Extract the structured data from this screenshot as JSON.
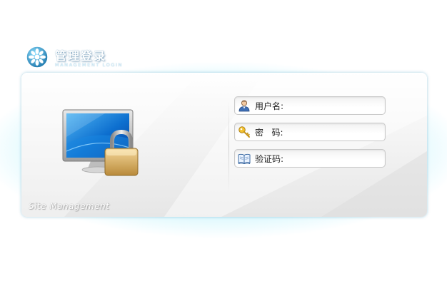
{
  "header": {
    "title": "管理登录",
    "subtitle": "MANAGEMENT LOGIN",
    "logo_icon": "gear-wheel-logo-icon"
  },
  "panel": {
    "illustration_icon": "monitor-padlock-icon",
    "watermark": "Site Management"
  },
  "form": {
    "username": {
      "label": "用户名:",
      "value": "",
      "icon": "user-icon"
    },
    "password": {
      "label": "密   码:",
      "value": "",
      "icon": "key-icon"
    },
    "captcha": {
      "label": "验证码:",
      "value": "",
      "icon": "book-icon"
    }
  },
  "colors": {
    "glow": "#00bdeb",
    "panel_top": "#ffffff",
    "panel_bottom": "#e6e6e6"
  }
}
